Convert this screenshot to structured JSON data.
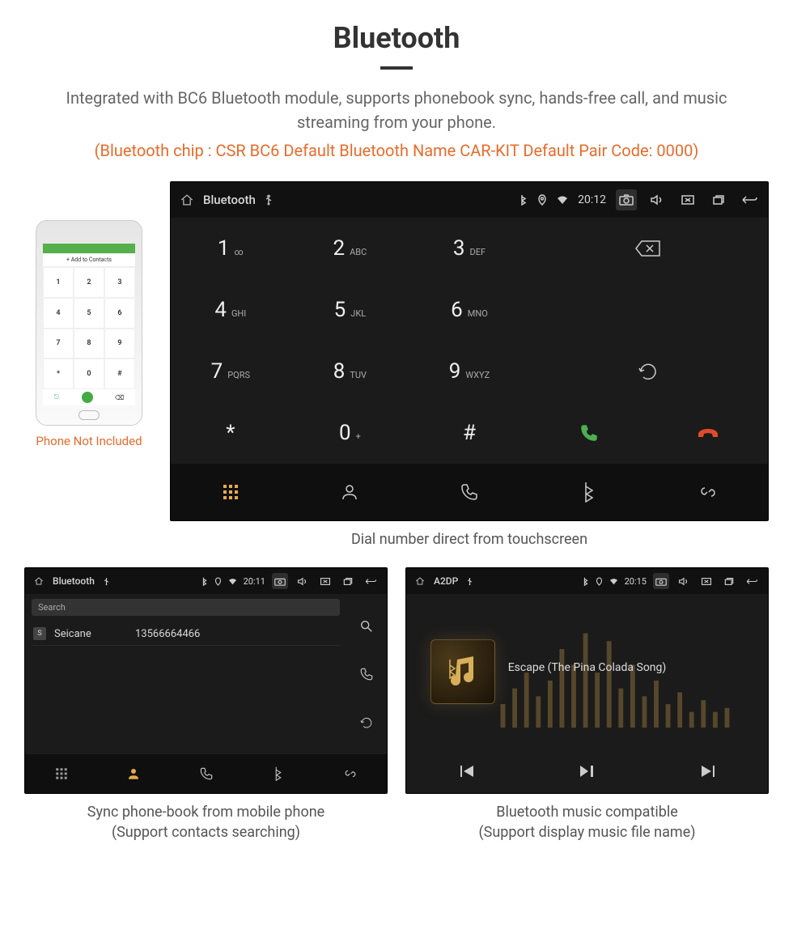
{
  "heading": "Bluetooth",
  "description": "Integrated with BC6 Bluetooth module, supports phonebook sync, hands-free call, and music streaming from your phone.",
  "spec": "(Bluetooth chip : CSR BC6     Default Bluetooth Name CAR-KIT     Default Pair Code: 0000)",
  "phone_caption": "Phone Not Included",
  "phone_mock": {
    "add_contacts": "+ Add to Contacts"
  },
  "dialer": {
    "status_title": "Bluetooth",
    "status_time": "20:12",
    "keypad": [
      {
        "num": "1",
        "let": "∞"
      },
      {
        "num": "2",
        "let": "ABC"
      },
      {
        "num": "3",
        "let": "DEF"
      },
      {
        "num": "4",
        "let": "GHI"
      },
      {
        "num": "5",
        "let": "JKL"
      },
      {
        "num": "6",
        "let": "MNO"
      },
      {
        "num": "7",
        "let": "PQRS"
      },
      {
        "num": "8",
        "let": "TUV"
      },
      {
        "num": "9",
        "let": "WXYZ"
      },
      {
        "num": "*",
        "let": ""
      },
      {
        "num": "0",
        "let": "+"
      },
      {
        "num": "#",
        "let": ""
      }
    ],
    "caption": "Dial number direct from touchscreen"
  },
  "contacts": {
    "status_title": "Bluetooth",
    "status_time": "20:11",
    "search_placeholder": "Search",
    "item": {
      "badge": "S",
      "name": "Seicane",
      "number": "13566664466"
    },
    "caption_l1": "Sync phone-book from mobile phone",
    "caption_l2": "(Support contacts searching)"
  },
  "music": {
    "status_title": "A2DP",
    "status_time": "20:15",
    "song": "Escape (The Pina Colada Song)",
    "caption_l1": "Bluetooth music compatible",
    "caption_l2": "(Support display music file name)"
  }
}
